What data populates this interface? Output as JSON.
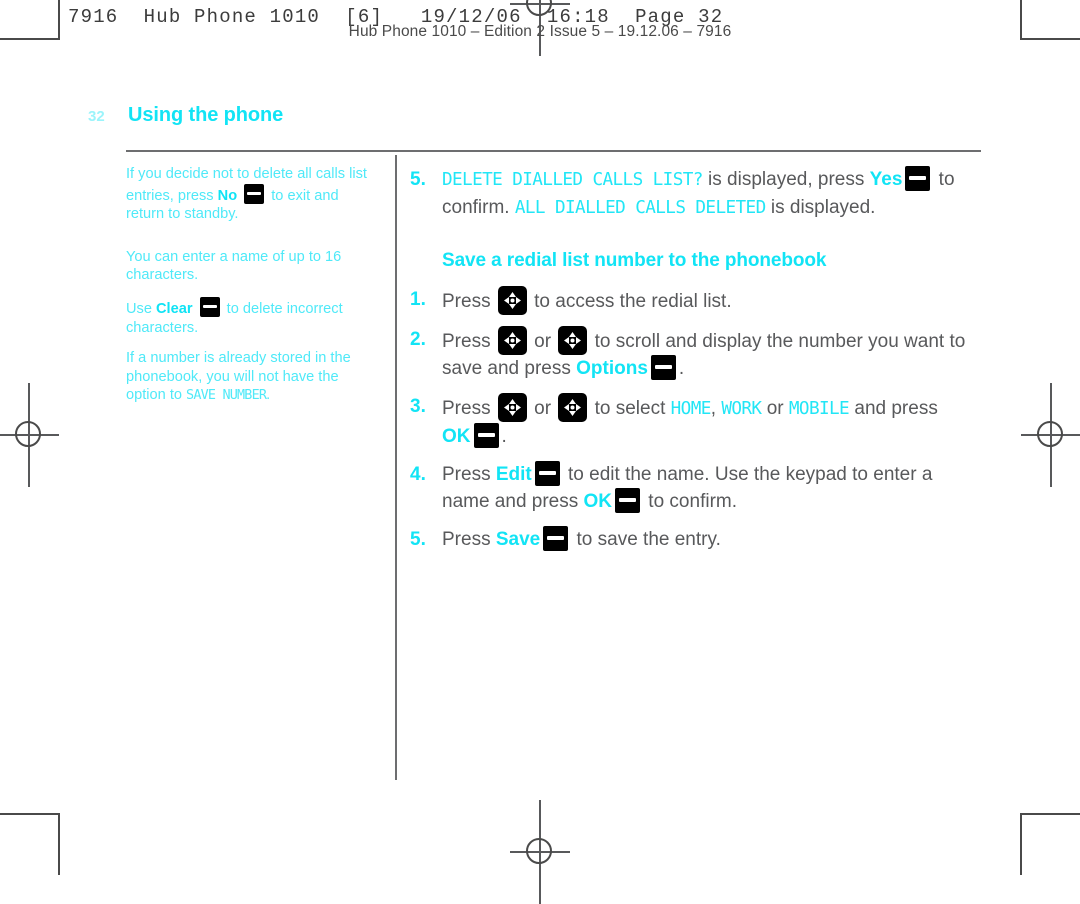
{
  "print_marks": {
    "slug": "7916  Hub Phone 1010  [6]   19/12/06  16:18  Page 32",
    "edition": "Hub Phone 1010 – Edition 2 Issue 5 – 19.12.06 – 7916"
  },
  "running_head": {
    "folio": "32",
    "chapter": "Using the phone"
  },
  "colors": {
    "cyan": "#12e4f5",
    "cyan_light": "#4fe9f8",
    "folio": "#9bf4fb",
    "body_text": "#58595b",
    "rule": "#6d6e70"
  },
  "sidebar": {
    "notes": [
      {
        "parts": [
          {
            "type": "text",
            "value": "If you decide not to delete all calls list entries, press "
          },
          {
            "type": "bold",
            "value": "No"
          },
          {
            "type": "softkey",
            "value": "softkey-icon"
          },
          {
            "type": "text",
            "value": " to exit and return to standby."
          }
        ]
      },
      {
        "parts": [
          {
            "type": "text",
            "value": "You can enter a name of up to 16 characters."
          }
        ]
      },
      {
        "parts": [
          {
            "type": "text",
            "value": "Use "
          },
          {
            "type": "bold",
            "value": "Clear"
          },
          {
            "type": "softkey",
            "value": "softkey-icon"
          },
          {
            "type": "text",
            "value": " to delete incorrect characters."
          }
        ]
      },
      {
        "parts": [
          {
            "type": "text",
            "value": "If a number is already stored in the phonebook, you will not have the option to "
          },
          {
            "type": "lcd",
            "value": "SAVE NUMBER"
          },
          {
            "type": "text",
            "value": "."
          }
        ]
      }
    ],
    "note1_a": "If you decide not to delete all calls list entries, press ",
    "note1_no": "No",
    "note1_b": " to exit and return to standby.",
    "note2": "You can enter a name of up to 16 characters.",
    "note3_a": "Use ",
    "note3_clear": "Clear",
    "note3_b": " to delete incorrect characters.",
    "note4_a": "If a number is already stored in the phonebook, you will not have the option to ",
    "note4_lcd": "SAVE NUMBER",
    "note4_b": "."
  },
  "main": {
    "step5_top": {
      "num": "5.",
      "lcd_prompt": "DELETE DIALLED CALLS LIST?",
      "text_a": " is displayed, press ",
      "kw_yes": "Yes",
      "text_b": " to confirm. ",
      "lcd_result": "ALL DIALLED CALLS DELETED",
      "text_c": " is displayed."
    },
    "section_heading": "Save a redial list number to the phonebook",
    "steps": [
      {
        "num": "1.",
        "text_a": "Press ",
        "text_b": " to access the redial list."
      },
      {
        "num": "2.",
        "text_a": "Press ",
        "text_mid": " or ",
        "text_b": " to scroll and display the number you want to save and press ",
        "kw": "Options",
        "text_c": "."
      },
      {
        "num": "3.",
        "text_a": "Press ",
        "text_mid": " or ",
        "text_b": " to select ",
        "lcd_home": "HOME",
        "sep1": ", ",
        "lcd_work": "WORK",
        "sep2": " or ",
        "lcd_mobile": "MOBILE",
        "text_c": " and press ",
        "kw": "OK",
        "text_d": "."
      },
      {
        "num": "4.",
        "text_a": "Press ",
        "kw1": "Edit",
        "text_b": " to edit the name. Use the keypad to enter a name and press ",
        "kw2": "OK",
        "text_c": " to confirm."
      },
      {
        "num": "5.",
        "text_a": "Press ",
        "kw": "Save",
        "text_b": " to save the entry."
      }
    ]
  }
}
